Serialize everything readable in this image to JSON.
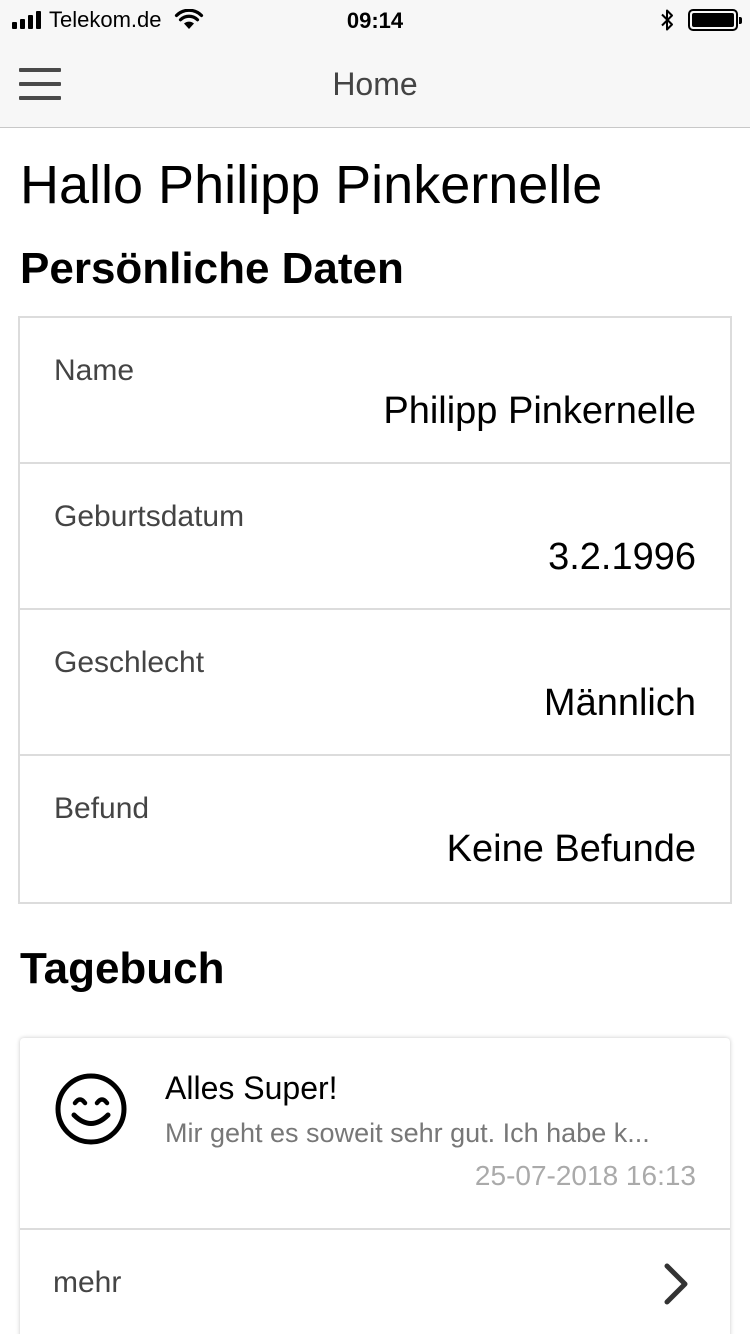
{
  "status_bar": {
    "carrier": "Telekom.de",
    "time": "09:14",
    "signal_icon": "signal-bars-icon",
    "wifi_icon": "wifi-icon",
    "bluetooth_icon": "bluetooth-icon",
    "battery_icon": "battery-icon",
    "battery_level": 1.0
  },
  "nav": {
    "title": "Home",
    "menu_icon": "hamburger-menu-icon"
  },
  "greeting": "Hallo Philipp Pinkernelle",
  "personal": {
    "title": "Persönliche Daten",
    "rows": [
      {
        "label": "Name",
        "value": "Philipp Pinkernelle"
      },
      {
        "label": "Geburtsdatum",
        "value": "3.2.1996"
      },
      {
        "label": "Geschlecht",
        "value": "Männlich"
      },
      {
        "label": "Befund",
        "value": "Keine Befunde"
      }
    ]
  },
  "diary": {
    "title": "Tagebuch",
    "entry": {
      "mood_icon": "smiley-face-icon",
      "title": "Alles Super!",
      "text": "Mir geht es soweit sehr gut. Ich habe k...",
      "timestamp": "25-07-2018 16:13"
    },
    "more_label": "mehr",
    "more_icon": "chevron-right-icon"
  }
}
